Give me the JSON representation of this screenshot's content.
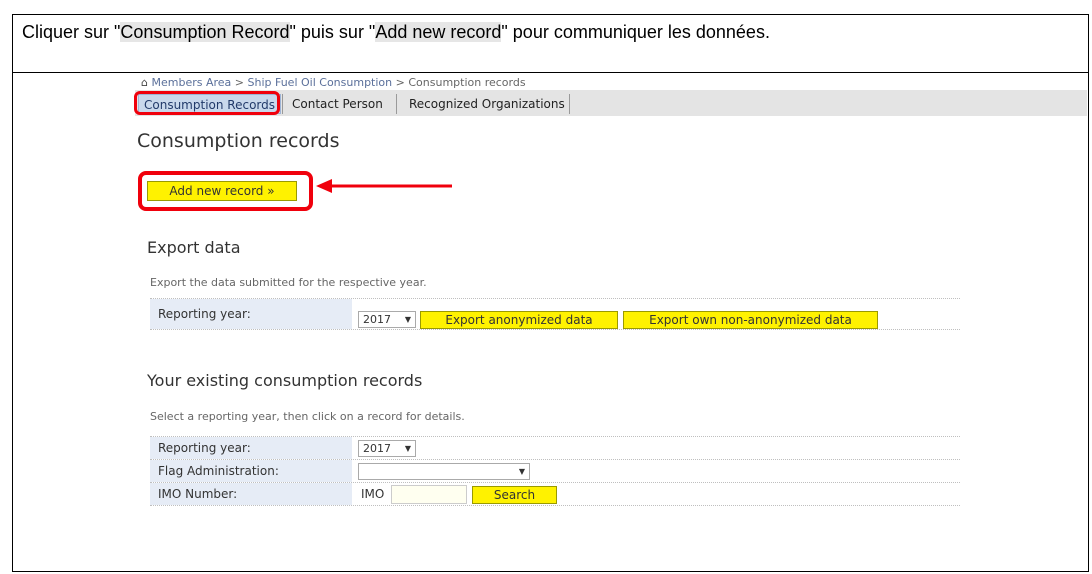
{
  "instruction": {
    "part1": "Cliquer sur \"",
    "hl1": "Consumption Record",
    "part2": "\" puis sur \"",
    "hl2": "Add new record",
    "part3": "\" pour communiquer les données."
  },
  "breadcrumb": {
    "home_icon": "⌂",
    "items": [
      "Members Area",
      "Ship Fuel Oil Consumption",
      "Consumption records"
    ],
    "separator": ">"
  },
  "tabs": [
    {
      "label": "Consumption Records",
      "active": true
    },
    {
      "label": "Contact Person",
      "active": false
    },
    {
      "label": "Recognized Organizations",
      "active": false
    }
  ],
  "page_title": "Consumption records",
  "add_button": "Add new record »",
  "export": {
    "title": "Export data",
    "description": "Export the data submitted for the respective year.",
    "year_label": "Reporting year:",
    "year_value": "2017",
    "anon_button": "Export anonymized data",
    "own_button": "Export own non-anonymized data"
  },
  "records": {
    "title": "Your existing consumption records",
    "description": "Select a reporting year, then click on a record for details.",
    "year_label": "Reporting year:",
    "year_value": "2017",
    "flag_label": "Flag Administration:",
    "flag_value": "",
    "imo_label": "IMO Number:",
    "imo_prefix": "IMO",
    "imo_value": "",
    "search_button": "Search"
  },
  "colors": {
    "highlight": "#f0000c",
    "button": "#fff200",
    "label_bg": "#e6ecf6"
  },
  "icons": {
    "caret": "▼",
    "home": "home-icon",
    "arrow": "red-arrow-icon"
  }
}
